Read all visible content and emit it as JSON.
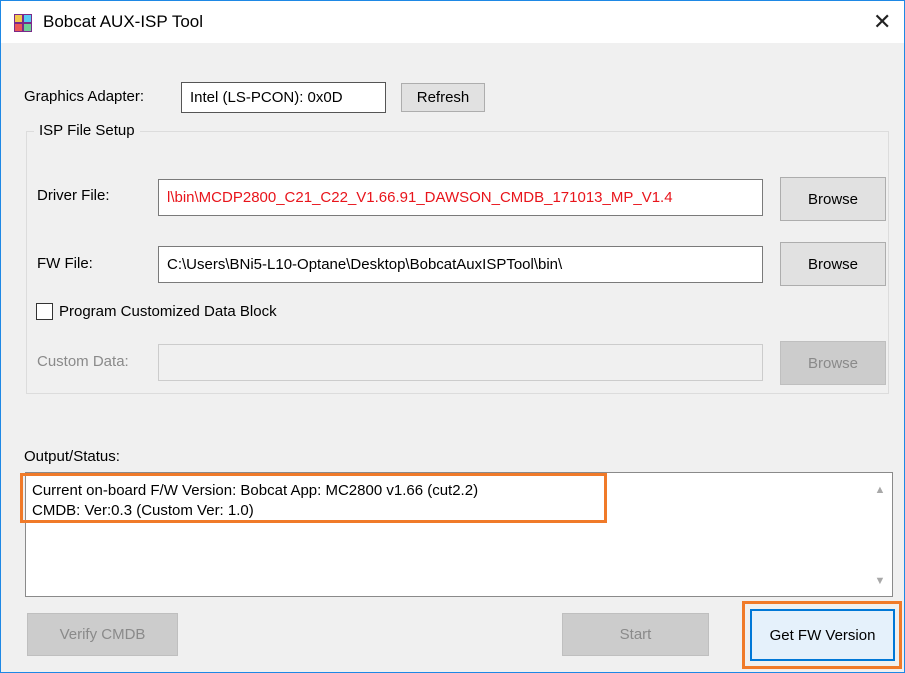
{
  "window": {
    "title": "Bobcat AUX-ISP Tool",
    "close_glyph": "✕"
  },
  "adapter": {
    "label": "Graphics Adapter:",
    "value": "Intel (LS-PCON): 0x0D",
    "refresh_label": "Refresh"
  },
  "isp_setup": {
    "group_title": "ISP File Setup",
    "driver_label": "Driver File:",
    "driver_value": "l\\bin\\MCDP2800_C21_C22_V1.66.91_DAWSON_CMDB_171013_MP_V1.4",
    "driver_browse": "Browse",
    "fw_label": "FW File:",
    "fw_value": "C:\\Users\\BNi5-L10-Optane\\Desktop\\BobcatAuxISPTool\\bin\\",
    "fw_browse": "Browse",
    "program_custom_label": "Program Customized Data Block",
    "program_custom_checked": false,
    "custom_data_label": "Custom Data:",
    "custom_data_value": "",
    "custom_browse": "Browse"
  },
  "output": {
    "label": "Output/Status:",
    "lines": [
      "Current on-board F/W Version: Bobcat App: MC2800 v1.66  (cut2.2)",
      "CMDB: Ver:0.3  (Custom Ver: 1.0)"
    ]
  },
  "actions": {
    "verify_cmdb": "Verify CMDB",
    "start": "Start",
    "get_fw_version": "Get FW Version"
  },
  "colors": {
    "driver_text": "#e8141b",
    "highlight": "#f07a29",
    "focus_border": "#0078d7"
  }
}
